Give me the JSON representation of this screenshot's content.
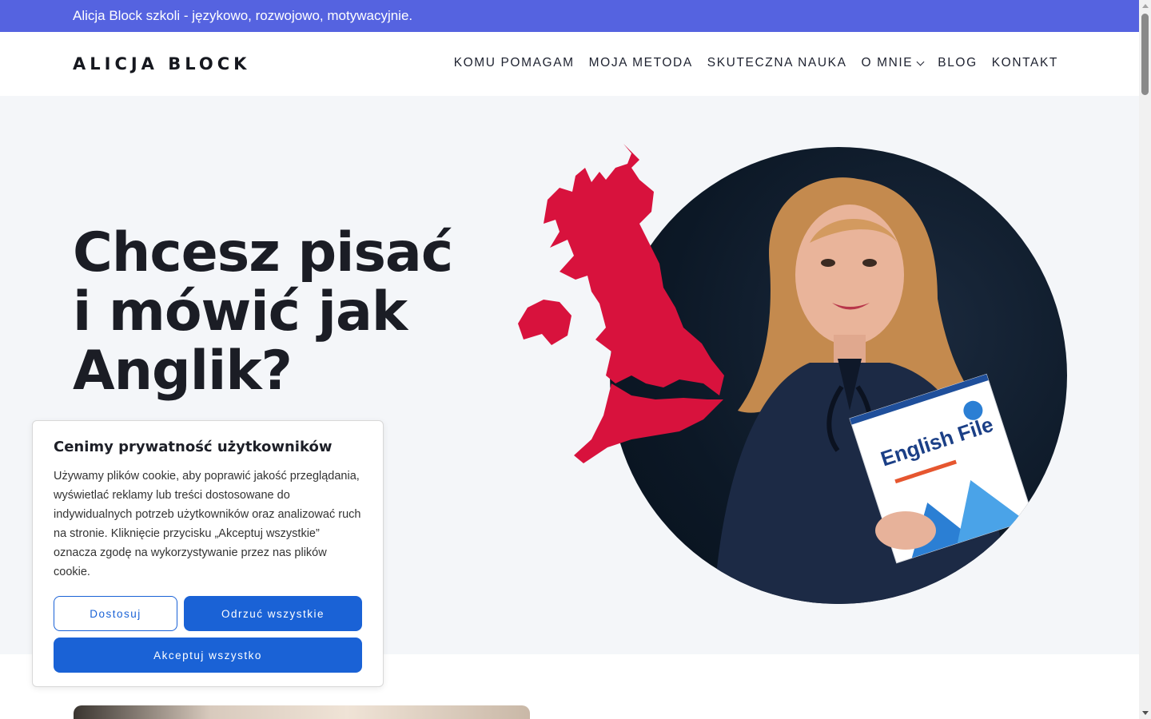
{
  "topbar": {
    "tagline": "Alicja Block szkoli - językowo, rozwojowo, motywacyjnie."
  },
  "header": {
    "logo": "ALICJA BLOCK",
    "nav": [
      {
        "label": "KOMU POMAGAM"
      },
      {
        "label": "MOJA METODA"
      },
      {
        "label": "SKUTECZNA NAUKA"
      },
      {
        "label": "O MNIE"
      },
      {
        "label": "BLOG"
      },
      {
        "label": "KONTAKT"
      }
    ]
  },
  "hero": {
    "headline_line1": "Chcesz pisać",
    "headline_line2": "i mówić jak",
    "headline_line3": "Anglik?",
    "book_title": "English File",
    "map_color": "#d8123d",
    "background": "#f4f6f9"
  },
  "cookie": {
    "title": "Cenimy prywatność użytkowników",
    "text": "Używamy plików cookie, aby poprawić jakość przeglądania, wyświetlać reklamy lub treści dostosowane do indywidualnych potrzeb użytkowników oraz analizować ruch na stronie. Kliknięcie przycisku „Akceptuj wszystkie” oznacza zgodę na wykorzystywanie przez nas plików cookie.",
    "customize_label": "Dostosuj",
    "reject_label": "Odrzuć wszystkie",
    "accept_label": "Akceptuj wszystko"
  },
  "colors": {
    "accent": "#1a62d6",
    "topbar": "#5563e0"
  }
}
